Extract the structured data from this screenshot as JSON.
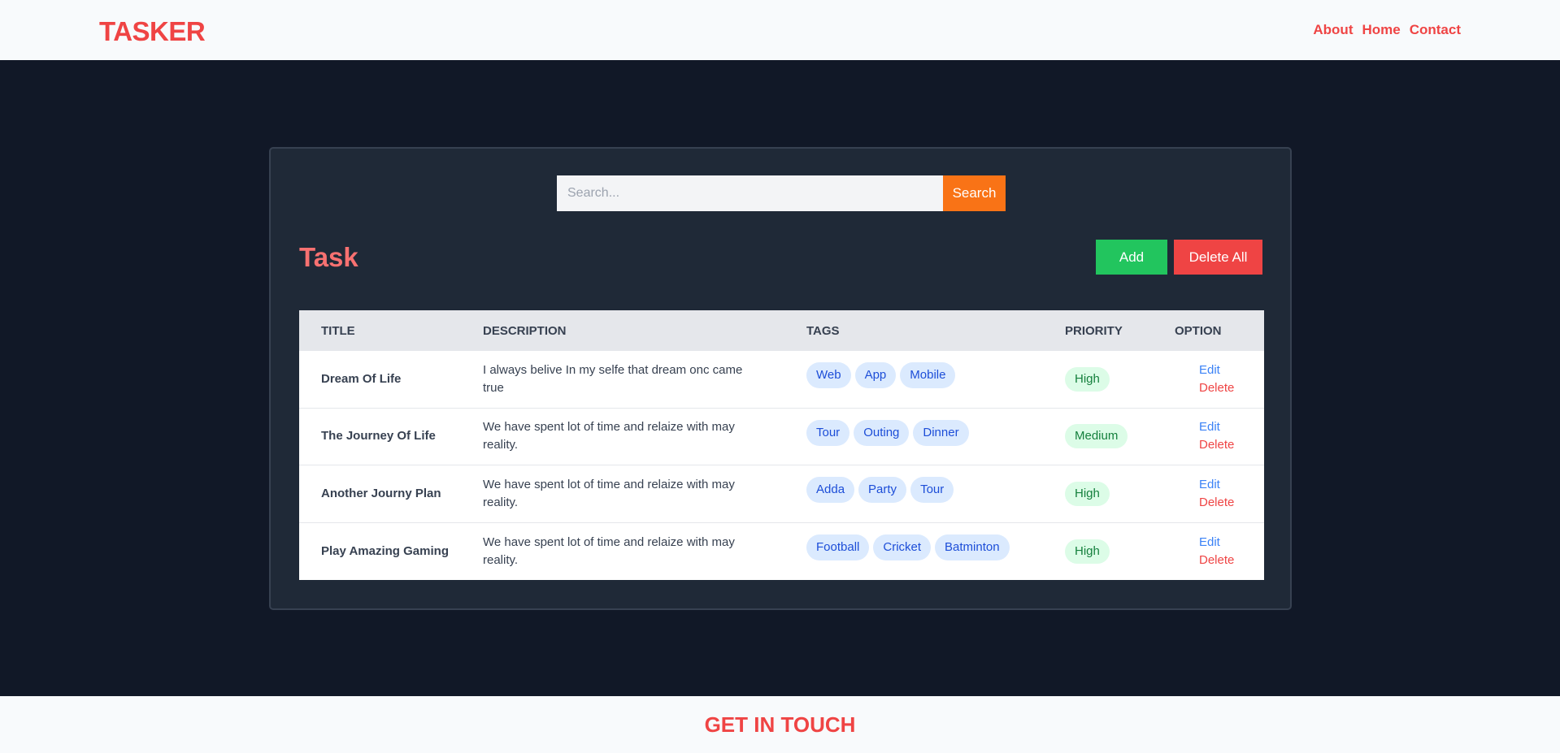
{
  "header": {
    "logo": "TASKER",
    "nav": [
      {
        "label": "About"
      },
      {
        "label": "Home"
      },
      {
        "label": "Contact"
      }
    ]
  },
  "search": {
    "placeholder": "Search...",
    "button_label": "Search"
  },
  "task_section": {
    "title": "Task",
    "add_label": "Add",
    "delete_all_label": "Delete All"
  },
  "table": {
    "columns": [
      "TITLE",
      "DESCRIPTION",
      "TAGS",
      "PRIORITY",
      "OPTION"
    ],
    "rows": [
      {
        "title": "Dream Of Life",
        "description": "I always belive In my selfe that dream onc came true",
        "tags": [
          "Web",
          "App",
          "Mobile"
        ],
        "priority": "High",
        "edit": "Edit",
        "delete": "Delete"
      },
      {
        "title": "The Journey Of Life",
        "description": "We have spent lot of time and relaize with may reality.",
        "tags": [
          "Tour",
          "Outing",
          "Dinner"
        ],
        "priority": "Medium",
        "edit": "Edit",
        "delete": "Delete"
      },
      {
        "title": "Another Journy Plan",
        "description": "We have spent lot of time and relaize with may reality.",
        "tags": [
          "Adda",
          "Party",
          "Tour"
        ],
        "priority": "High",
        "edit": "Edit",
        "delete": "Delete"
      },
      {
        "title": "Play Amazing Gaming",
        "description": "We have spent lot of time and relaize with may reality.",
        "tags": [
          "Football",
          "Cricket",
          "Batminton"
        ],
        "priority": "High",
        "edit": "Edit",
        "delete": "Delete"
      }
    ]
  },
  "footer": {
    "title": "GET IN TOUCH"
  },
  "colors": {
    "accent": "#ef4444",
    "search_button": "#f97316",
    "add_button": "#22c55e",
    "background": "#111827",
    "panel": "#1f2937"
  }
}
